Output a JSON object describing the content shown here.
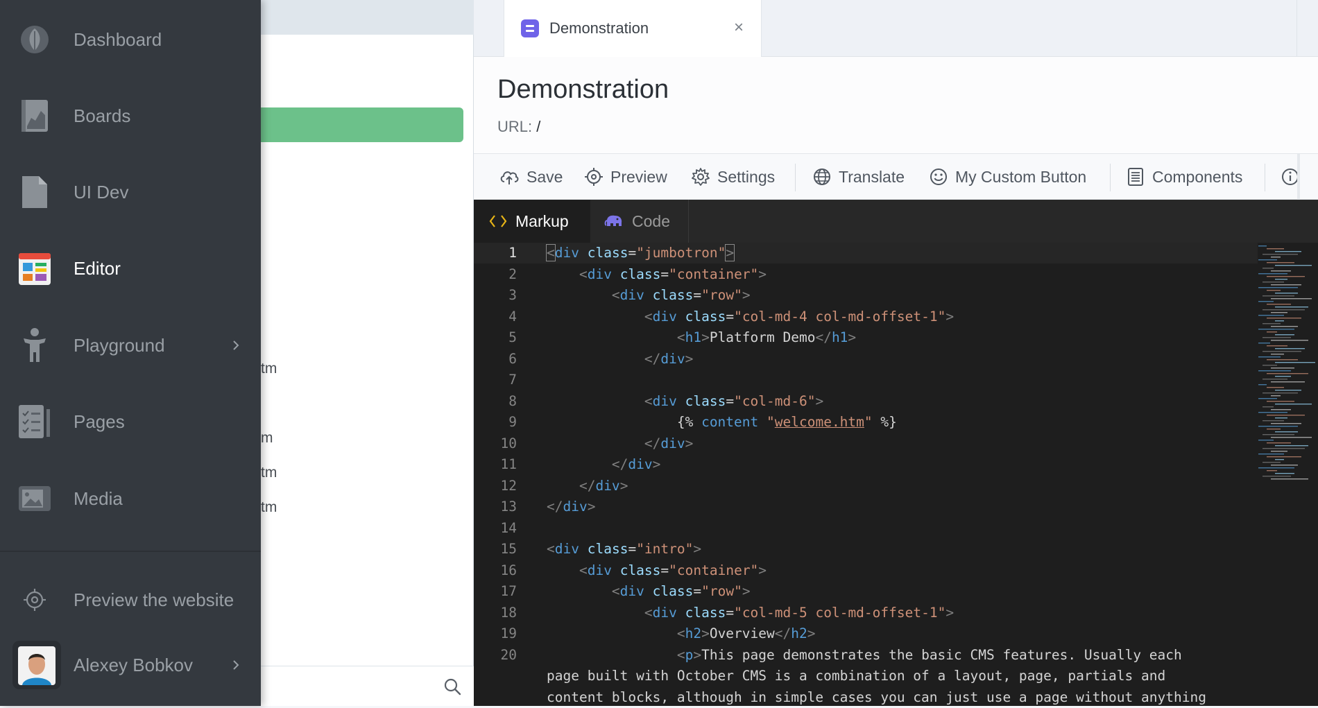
{
  "sidebar": {
    "items": [
      {
        "label": "Dashboard",
        "icon": "leaf-icon"
      },
      {
        "label": "Boards",
        "icon": "chart-book-icon"
      },
      {
        "label": "UI Dev",
        "icon": "file-icon"
      },
      {
        "label": "Editor",
        "icon": "editor-icon",
        "active": true
      },
      {
        "label": "Playground",
        "icon": "person-icon",
        "has_submenu": true
      },
      {
        "label": "Pages",
        "icon": "checklist-icon"
      },
      {
        "label": "Media",
        "icon": "image-icon"
      }
    ],
    "preview_label": "Preview the website",
    "user_name": "Alexey Bobkov"
  },
  "middle_panel": {
    "fragments": [
      "tm",
      "m",
      "tm",
      "tm"
    ]
  },
  "tab": {
    "label": "Demonstration",
    "close_glyph": "×"
  },
  "header": {
    "title": "Demonstration",
    "url_label": "URL:",
    "url_value": "/"
  },
  "toolbar": {
    "save": "Save",
    "preview": "Preview",
    "settings": "Settings",
    "translate": "Translate",
    "custom": "My Custom Button",
    "components": "Components"
  },
  "editor": {
    "tabs": [
      "Markup",
      "Code"
    ],
    "current_line": 1,
    "lines": [
      "<div class=\"jumbotron\">",
      "    <div class=\"container\">",
      "        <div class=\"row\">",
      "            <div class=\"col-md-4 col-md-offset-1\">",
      "                <h1>Platform Demo</h1>",
      "            </div>",
      "",
      "            <div class=\"col-md-6\">",
      "                {% content \"welcome.htm\" %}",
      "            </div>",
      "        </div>",
      "    </div>",
      "</div>",
      "",
      "<div class=\"intro\">",
      "    <div class=\"container\">",
      "        <div class=\"row\">",
      "            <div class=\"col-md-5 col-md-offset-1\">",
      "                <h2>Overview</h2>",
      "                <p>This page demonstrates the basic CMS features. Usually each",
      "page built with October CMS is a combination of a layout, page, partials and",
      "content blocks, although in simple cases you can just use a page without anything"
    ]
  },
  "colors": {
    "sidebar_bg": "#34393f",
    "accent_green": "#6cc18a",
    "tab_icon": "#6f63e8",
    "editor_bg": "#1e1e1e"
  }
}
